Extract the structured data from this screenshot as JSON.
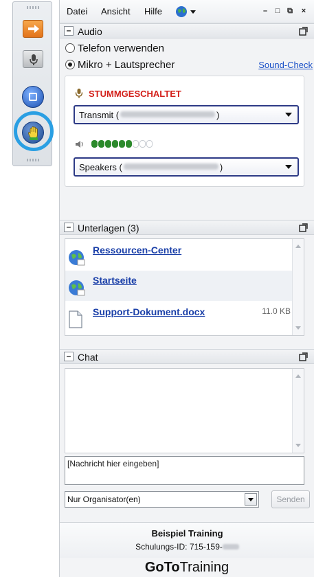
{
  "menubar": {
    "items": [
      "Datei",
      "Ansicht",
      "Hilfe"
    ],
    "globe_icon": "globe-dropdown-icon",
    "window_controls": [
      "minimize-icon",
      "restore-icon",
      "popout-icon",
      "close-icon"
    ]
  },
  "toolbar": {
    "icons": [
      "collapse-arrow-icon",
      "microphone-icon",
      "screen-share-icon",
      "raise-hand-icon"
    ],
    "highlight_color": "#2a9fe3"
  },
  "audio": {
    "section_title": "Audio",
    "option_phone": "Telefon verwenden",
    "option_mic": "Mikro + Lautsprecher",
    "selected_option": "Mikro + Lautsprecher",
    "sound_check": "Sound-Check",
    "mute_status": "STUMMGESCHALTET",
    "mute_color": "#d3201a",
    "transmit_prefix": "Transmit (",
    "transmit_suffix": ")",
    "speakers_prefix": "Speakers (",
    "speakers_suffix": ")",
    "input_level": {
      "active": 6,
      "total": 9
    }
  },
  "handouts": {
    "section_title": "Unterlagen (3)",
    "items": [
      {
        "name": "Ressourcen-Center",
        "size": "",
        "icon": "web-link-icon"
      },
      {
        "name": "Startseite",
        "size": "",
        "icon": "web-link-icon"
      },
      {
        "name": "Support-Dokument.docx",
        "size": "11.0 KB",
        "icon": "document-icon"
      }
    ]
  },
  "chat": {
    "section_title": "Chat",
    "input_placeholder": "[Nachricht hier eingeben]",
    "recipient": "Nur Organisator(en)",
    "send_label": "Senden"
  },
  "footer": {
    "training_name": "Beispiel Training",
    "training_id_label": "Schulungs-ID: 715-159-",
    "brand_bold": "GoTo",
    "brand_light": "Training"
  }
}
